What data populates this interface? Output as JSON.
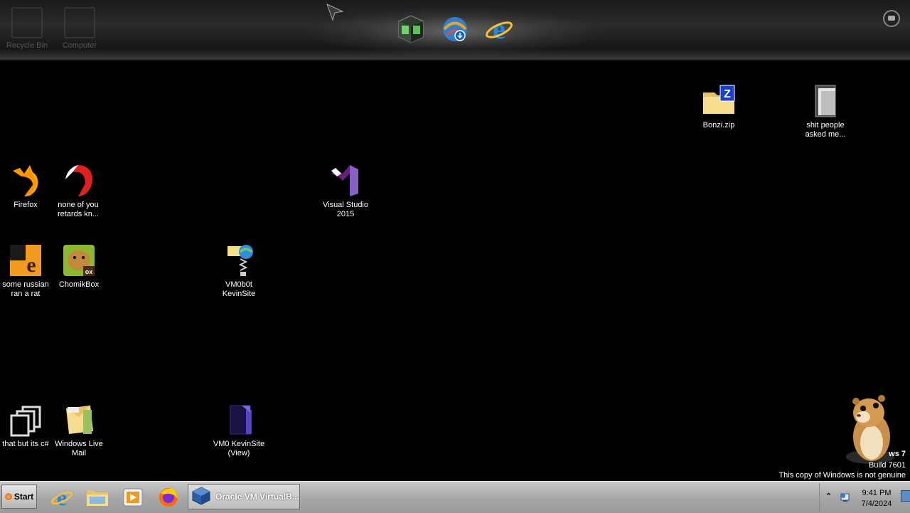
{
  "dock": {
    "ghost_items": [
      {
        "label": "Recycle Bin"
      },
      {
        "label": "Computer"
      }
    ],
    "items": [
      {
        "icon": "media-player-icon"
      },
      {
        "icon": "download-globe-icon"
      },
      {
        "icon": "internet-explorer-icon"
      }
    ]
  },
  "desktop_icons": [
    {
      "label": "Bonzi.zip",
      "icon": "zip-folder-icon"
    },
    {
      "label": "shit people asked me...",
      "icon": "folder-icon"
    },
    {
      "label": "Firefox",
      "icon": "firefox-icon"
    },
    {
      "label": "none of you retards kn...",
      "icon": "red-shortcut-icon"
    },
    {
      "label": "Visual Studio 2015",
      "icon": "visual-studio-icon"
    },
    {
      "label": "some russian ran a rat",
      "icon": "orange-app-icon"
    },
    {
      "label": "ChomikBox",
      "icon": "chomikbox-icon"
    },
    {
      "label": "VM0b0t KevinSite",
      "icon": "web-file-icon"
    },
    {
      "label": "that but its c#",
      "icon": "files-icon"
    },
    {
      "label": "Windows Live Mail",
      "icon": "mail-icon"
    },
    {
      "label": "VM0 KevinSite (View)",
      "icon": "document-icon"
    }
  ],
  "watermark": {
    "line1": "ws 7",
    "line2": "Build 7601",
    "line3": "This copy of Windows is not genuine"
  },
  "taskbar": {
    "start_label": "Start",
    "pinned": [
      {
        "icon": "internet-explorer-icon"
      },
      {
        "icon": "file-explorer-icon"
      },
      {
        "icon": "media-player-icon"
      },
      {
        "icon": "firefox-icon"
      }
    ],
    "active_task": {
      "label": "Oracle VM VirtualB...",
      "icon": "virtualbox-icon"
    },
    "tray": {
      "overflow_arrow": "⌃",
      "time": "9:41 PM",
      "date": "7/4/2024"
    }
  },
  "colors": {
    "desktop": "#000000",
    "taskbar": "#b0b0b0",
    "visual_studio_purple": "#68217a",
    "firefox_orange": "#ff9500",
    "folder_yellow": "#f3d47b"
  }
}
